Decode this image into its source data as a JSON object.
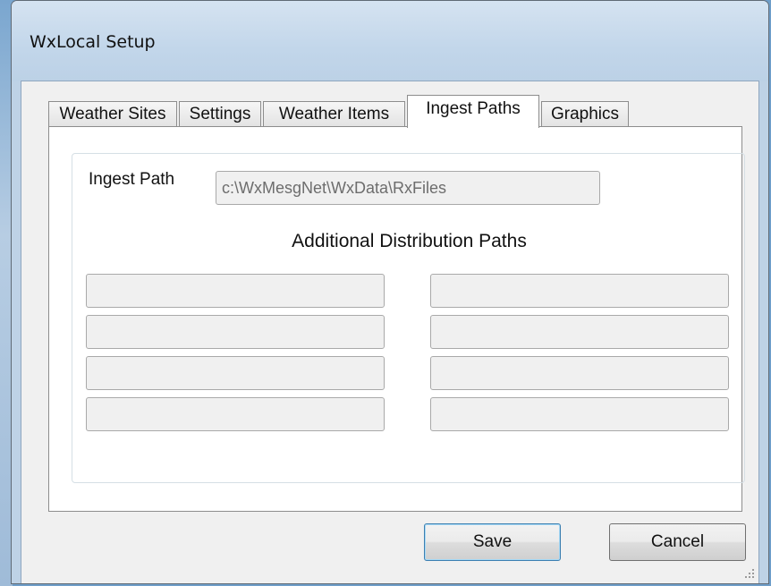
{
  "window": {
    "title": "WxLocal Setup"
  },
  "tabs": [
    {
      "label": "Weather Sites",
      "selected": false
    },
    {
      "label": "Settings",
      "selected": false
    },
    {
      "label": "Weather Items",
      "selected": false
    },
    {
      "label": "Ingest Paths",
      "selected": true
    },
    {
      "label": "Graphics",
      "selected": false
    }
  ],
  "ingest": {
    "label": "Ingest Path",
    "value": "c:\\WxMesgNet\\WxData\\RxFiles"
  },
  "distribution": {
    "title": "Additional Distribution Paths",
    "left_paths": [
      "",
      "",
      "",
      ""
    ],
    "right_paths": [
      "",
      "",
      "",
      ""
    ]
  },
  "buttons": {
    "save_label": "Save",
    "cancel_label": "Cancel"
  }
}
